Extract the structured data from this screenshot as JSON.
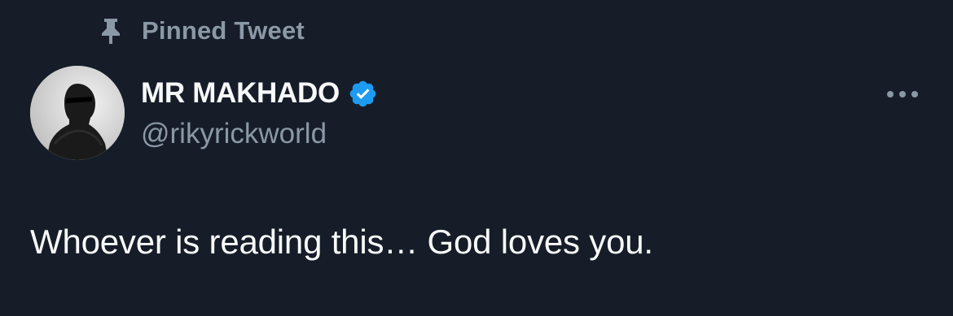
{
  "pinned": {
    "icon": "pin-icon",
    "label": "Pinned Tweet"
  },
  "author": {
    "display_name": "MR MAKHADO",
    "handle": "@rikyrickworld",
    "verified": true,
    "verified_icon": "verified-badge-icon",
    "verified_color": "#1d9bf0"
  },
  "actions": {
    "more_icon": "more-dots-icon"
  },
  "tweet": {
    "text": "Whoever is reading this… God loves you."
  },
  "colors": {
    "background": "#161d29",
    "primary_text": "#f7f9f9",
    "secondary_text": "#8b98a5"
  }
}
